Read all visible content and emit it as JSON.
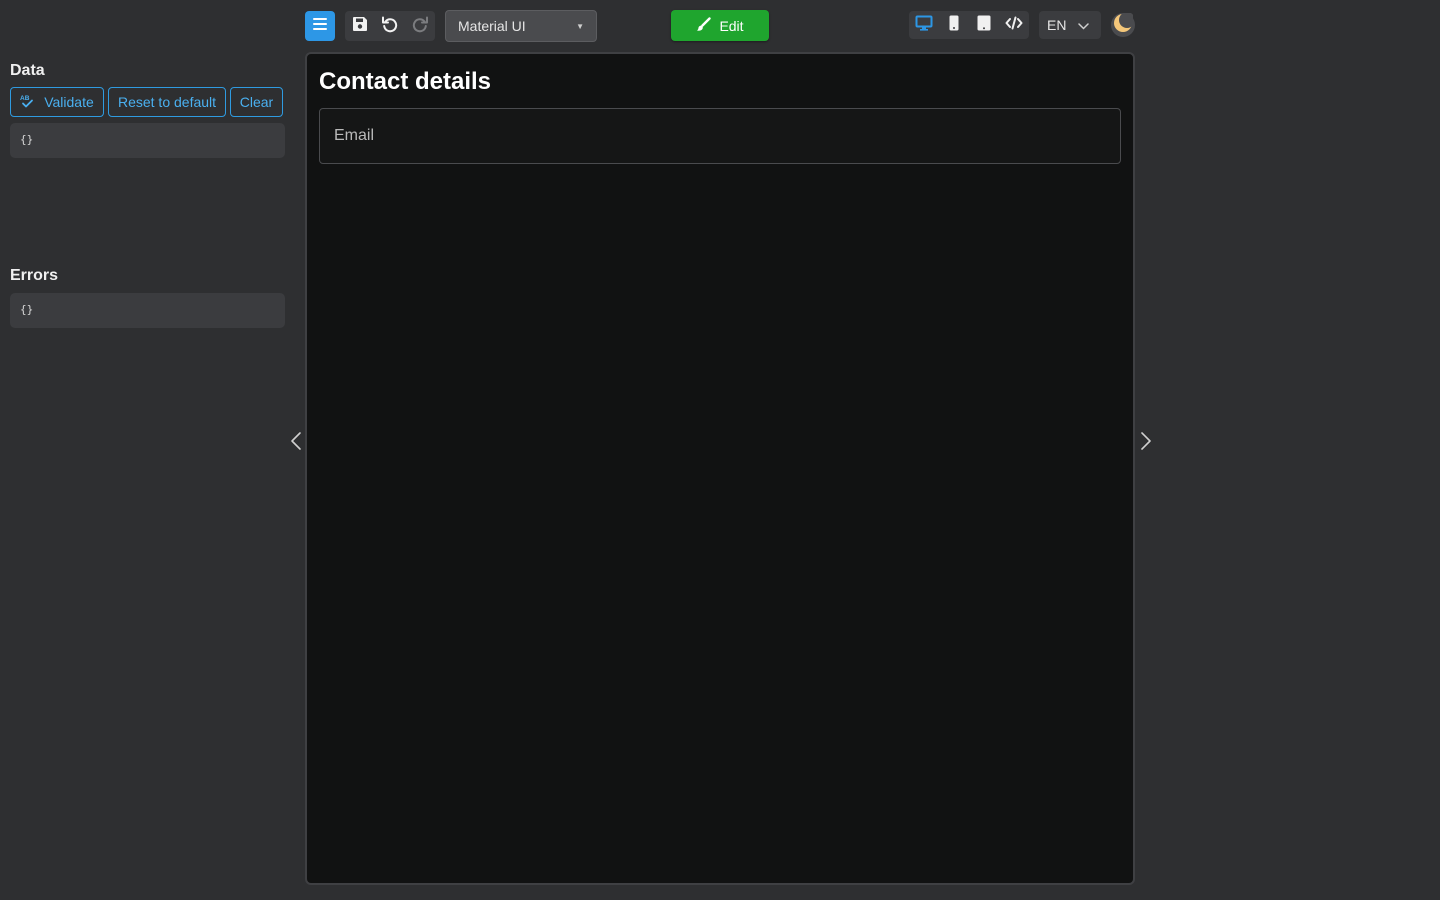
{
  "toolbar": {
    "theme_select": {
      "value": "Material UI"
    },
    "edit_label": "Edit",
    "language_select": {
      "value": "EN"
    },
    "colors": {
      "accent": "#2d97e6",
      "edit": "#1fa52e"
    }
  },
  "left_panel": {
    "data_section": {
      "title": "Data",
      "buttons": {
        "validate": "Validate",
        "reset": "Reset to default",
        "clear": "Clear"
      },
      "content": "{}"
    },
    "errors_section": {
      "title": "Errors",
      "content": "{}"
    }
  },
  "preview": {
    "form_title": "Contact details",
    "fields": [
      {
        "label": "Email",
        "value": ""
      }
    ]
  }
}
